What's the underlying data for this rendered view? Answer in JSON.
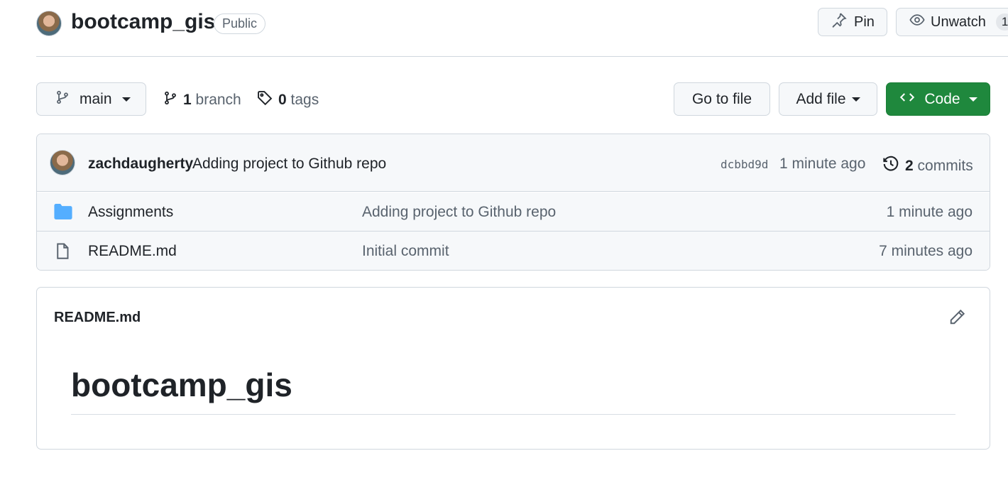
{
  "repo": {
    "name": "bootcamp_gis",
    "visibility": "Public"
  },
  "header_actions": {
    "pin_label": "Pin",
    "watch_label": "Unwatch",
    "watch_count": "1"
  },
  "branch_bar": {
    "current_branch": "main",
    "branch_count": "1",
    "branch_word": "branch",
    "tag_count": "0",
    "tag_word": "tags",
    "go_to_file_label": "Go to file",
    "add_file_label": "Add file",
    "code_label": "Code"
  },
  "latest_commit": {
    "author": "zachdaugherty",
    "message": "Adding project to Github repo",
    "hash": "dcbbd9d",
    "time": "1 minute ago",
    "commit_count": "2",
    "commit_word": "commits"
  },
  "files": [
    {
      "type": "folder",
      "name": "Assignments",
      "commit": "Adding project to Github repo",
      "time": "1 minute ago"
    },
    {
      "type": "file",
      "name": "README.md",
      "commit": "Initial commit",
      "time": "7 minutes ago"
    }
  ],
  "readme": {
    "filename": "README.md",
    "heading": "bootcamp_gis"
  },
  "colors": {
    "primary_green": "#1f883d",
    "folder_blue": "#54aeff",
    "muted_text": "#59636e",
    "border": "#d0d7de"
  }
}
